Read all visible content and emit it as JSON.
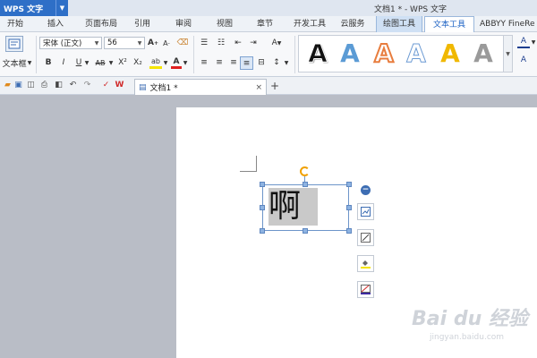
{
  "title_bar": {
    "app_name": "WPS 文字",
    "window_title": "文档1 * - WPS 文字"
  },
  "tabs": [
    {
      "label": "开始"
    },
    {
      "label": "插入"
    },
    {
      "label": "页面布局"
    },
    {
      "label": "引用"
    },
    {
      "label": "审阅"
    },
    {
      "label": "视图"
    },
    {
      "label": "章节"
    },
    {
      "label": "开发工具"
    },
    {
      "label": "云服务"
    },
    {
      "label": "绘图工具"
    },
    {
      "label": "文本工具"
    },
    {
      "label": "ABBYY FineRe"
    }
  ],
  "ribbon": {
    "textbox_label": "文本框",
    "font_name": "宋体 (正文)",
    "font_size": "56",
    "bold": "B",
    "italic": "I",
    "underline": "U",
    "strikethrough": "AB",
    "superscript": "X²",
    "subscript": "X₂",
    "font_color_letter": "A",
    "highlight_letter": "ab",
    "grow_font": "A+",
    "shrink_font": "A-",
    "style_letter": "A",
    "gallery_letters": [
      "A",
      "A",
      "A",
      "A",
      "A",
      "A"
    ],
    "right_letters": [
      "A",
      "A"
    ]
  },
  "doc_tab": {
    "label": "文档1 *",
    "close": "×",
    "new_tab": "+"
  },
  "document": {
    "textbox_text": "啊"
  },
  "colors": {
    "accent": "#2e6fc7",
    "active_tab_text": "#1e63c4",
    "selection_border": "#6d95c9",
    "rotate_handle": "#f0a000"
  },
  "watermark": {
    "brand": "Bai du 经验",
    "url": "jingyan.baidu.com"
  }
}
